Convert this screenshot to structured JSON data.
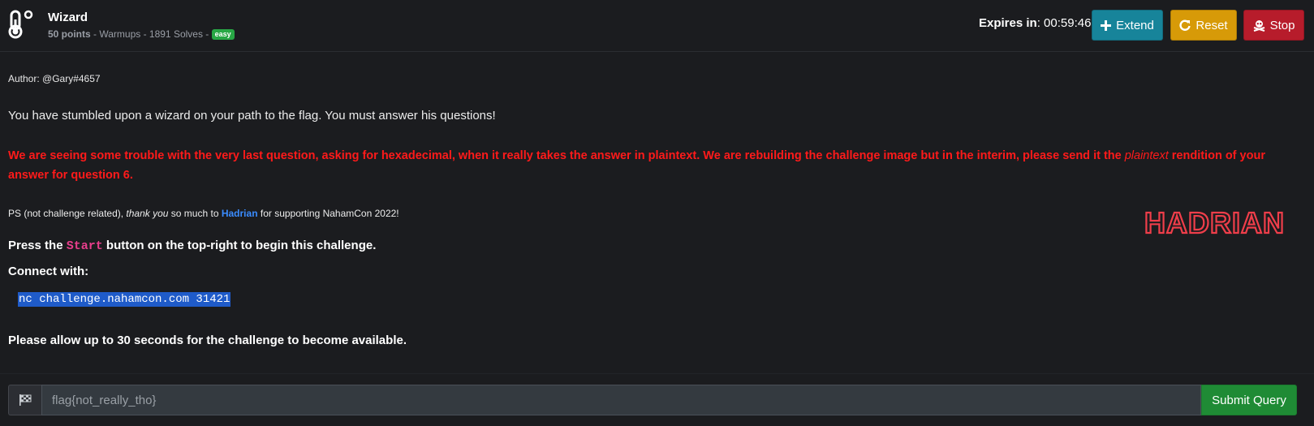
{
  "header": {
    "title": "Wizard",
    "points": "50 points",
    "meta_rest": " - Warmups - 1891 Solves - ",
    "difficulty": "easy",
    "expires_label": "Expires in",
    "expires_value": ": 00:59:46",
    "extend_label": "Extend",
    "reset_label": "Reset",
    "stop_label": "Stop",
    "colors": {
      "extend": "#17849a",
      "reset": "#d79a08",
      "stop": "#b71c2b",
      "badge": "#28a745"
    }
  },
  "challenge": {
    "author": "Author: @Gary#4657",
    "description": "You have stumbled upon a wizard on your path to the flag. You must answer his questions!",
    "warning_part1": "We are seeing some trouble with the very last question, asking for hexadecimal, when it really takes the answer in plaintext. We are rebuilding the challenge image but in the interim, please send it the ",
    "warning_em": "plaintext",
    "warning_part2": " rendition of your answer for question 6.",
    "ps_prefix": "PS (not challenge related), ",
    "ps_em": "thank you",
    "ps_mid": " so much to ",
    "ps_link": "Hadrian",
    "ps_suffix": " for supporting NahamCon 2022!",
    "sponsor_logo_text": "HADRIAN",
    "press_prefix": "Press the ",
    "press_code": "Start",
    "press_suffix": " button on the top-right to begin this challenge.",
    "connect_label": "Connect with:",
    "connect_command": "nc challenge.nahamcon.com 31421",
    "allow_text": "Please allow up to 30 seconds for the challenge to become available."
  },
  "flag_form": {
    "placeholder": "flag{not_really_tho}",
    "submit_label": "Submit Query"
  }
}
